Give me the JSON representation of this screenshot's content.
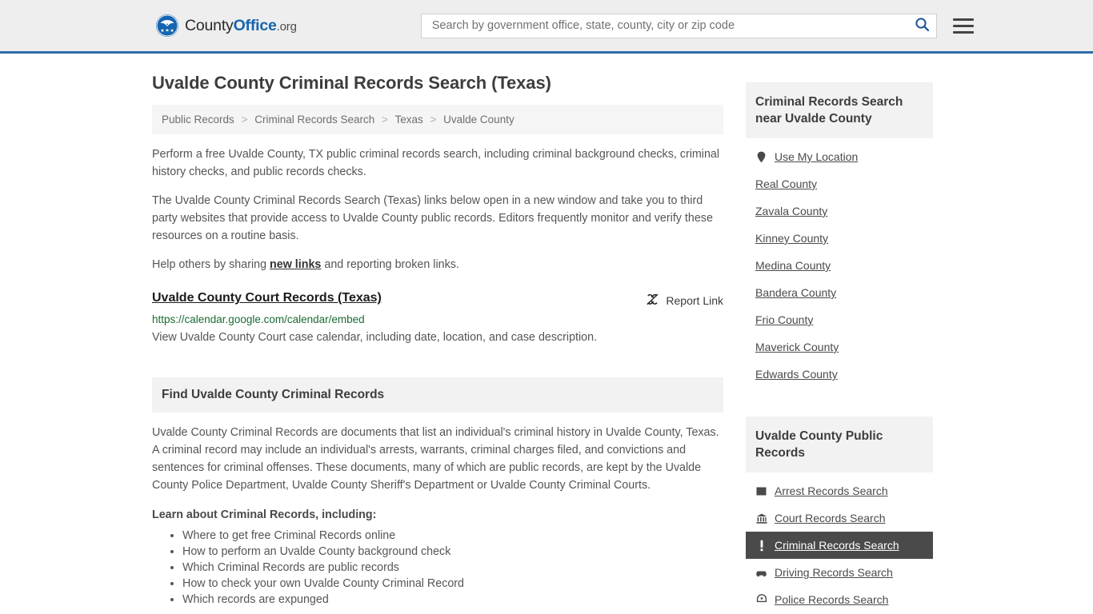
{
  "header": {
    "brand": {
      "part1": "County",
      "part2": "Office",
      "part3": ".org",
      "logo_icon": "eagle-seal-logo"
    },
    "search": {
      "placeholder": "Search by government office, state, county, city or zip code",
      "value": "",
      "search_icon": "search-icon"
    },
    "menu_icon": "hamburger-menu-icon",
    "accent_color": "#2f6ca8"
  },
  "page": {
    "title": "Uvalde County Criminal Records Search (Texas)",
    "breadcrumb": [
      "Public Records",
      "Criminal Records Search",
      "Texas",
      "Uvalde County"
    ],
    "breadcrumb_separator": ">",
    "paragraphs": {
      "p1": "Perform a free Uvalde County, TX public criminal records search, including criminal background checks, criminal history checks, and public records checks.",
      "p2": "The Uvalde County Criminal Records Search (Texas) links below open in a new window and take you to third party websites that provide access to Uvalde County public records. Editors frequently monitor and verify these resources on a routine basis.",
      "p3_before": "Help others by sharing ",
      "p3_link": "new links",
      "p3_after": " and reporting broken links."
    }
  },
  "result": {
    "title": "Uvalde County Court Records (Texas)",
    "report_label": "Report Link",
    "report_icon": "broken-link-icon",
    "url": "https://calendar.google.com/calendar/embed",
    "url_color": "#1a6b33",
    "description": "View Uvalde County Court case calendar, including date, location, and case description."
  },
  "section": {
    "heading": "Find Uvalde County Criminal Records",
    "paragraph": "Uvalde County Criminal Records are documents that list an individual's criminal history in Uvalde County, Texas. A criminal record may include an individual's arrests, warrants, criminal charges filed, and convictions and sentences for criminal offenses. These documents, many of which are public records, are kept by the Uvalde County Police Department, Uvalde County Sheriff's Department or Uvalde County Criminal Courts.",
    "learn_heading": "Learn about Criminal Records, including:",
    "learn_items": [
      "Where to get free Criminal Records online",
      "How to perform an Uvalde County background check",
      "Which Criminal Records are public records",
      "How to check your own Uvalde County Criminal Record",
      "Which records are expunged"
    ]
  },
  "sidebar": {
    "nearby": {
      "heading": "Criminal Records Search near Uvalde County",
      "use_my_location": {
        "label": "Use My Location",
        "icon": "map-pin-icon"
      },
      "counties": [
        "Real County",
        "Zavala County",
        "Kinney County",
        "Medina County",
        "Bandera County",
        "Frio County",
        "Maverick County",
        "Edwards County"
      ]
    },
    "public_records": {
      "heading": "Uvalde County Public Records",
      "items": [
        {
          "label": "Arrest Records Search",
          "icon": "fingerprint-card-icon",
          "active": false
        },
        {
          "label": "Court Records Search",
          "icon": "courthouse-icon",
          "active": false
        },
        {
          "label": "Criminal Records Search",
          "icon": "exclamation-icon",
          "active": true
        },
        {
          "label": "Driving Records Search",
          "icon": "car-icon",
          "active": false
        },
        {
          "label": "Police Records Search",
          "icon": "police-badge-icon",
          "active": false
        }
      ],
      "active_bg": "#4a4a4a"
    }
  }
}
